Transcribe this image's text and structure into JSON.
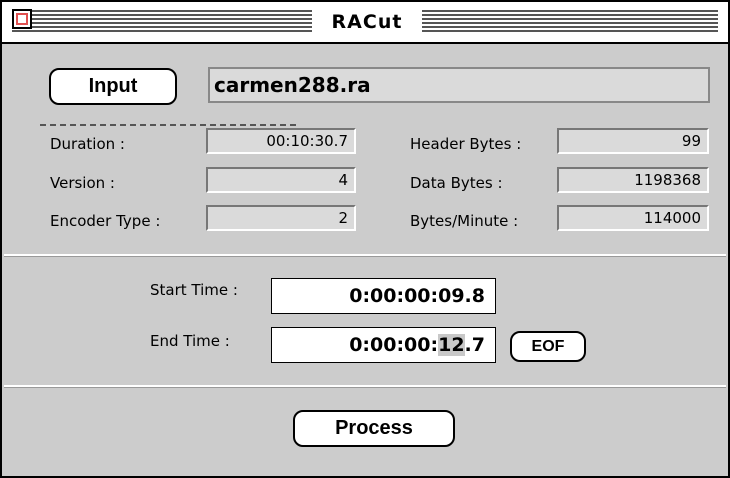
{
  "window": {
    "title": "RACut"
  },
  "input": {
    "button_label": "Input",
    "filename": "carmen288.ra"
  },
  "info": {
    "duration": {
      "label": "Duration :",
      "value": "00:10:30.7"
    },
    "version": {
      "label": "Version :",
      "value": "4"
    },
    "encoder_type": {
      "label": "Encoder Type :",
      "value": "2"
    },
    "header_bytes": {
      "label": "Header Bytes :",
      "value": "99"
    },
    "data_bytes": {
      "label": "Data Bytes :",
      "value": "1198368"
    },
    "bytes_per_minute": {
      "label": "Bytes/Minute :",
      "value": "114000"
    }
  },
  "cut": {
    "start_label": "Start Time :",
    "start_value": "0:00:00:09.8",
    "end_label": "End Time :",
    "end_value_prefix": "0:00:00:",
    "end_value_selected": "12",
    "end_value_suffix": ".7",
    "eof_label": "EOF"
  },
  "process": {
    "button_label": "Process"
  }
}
